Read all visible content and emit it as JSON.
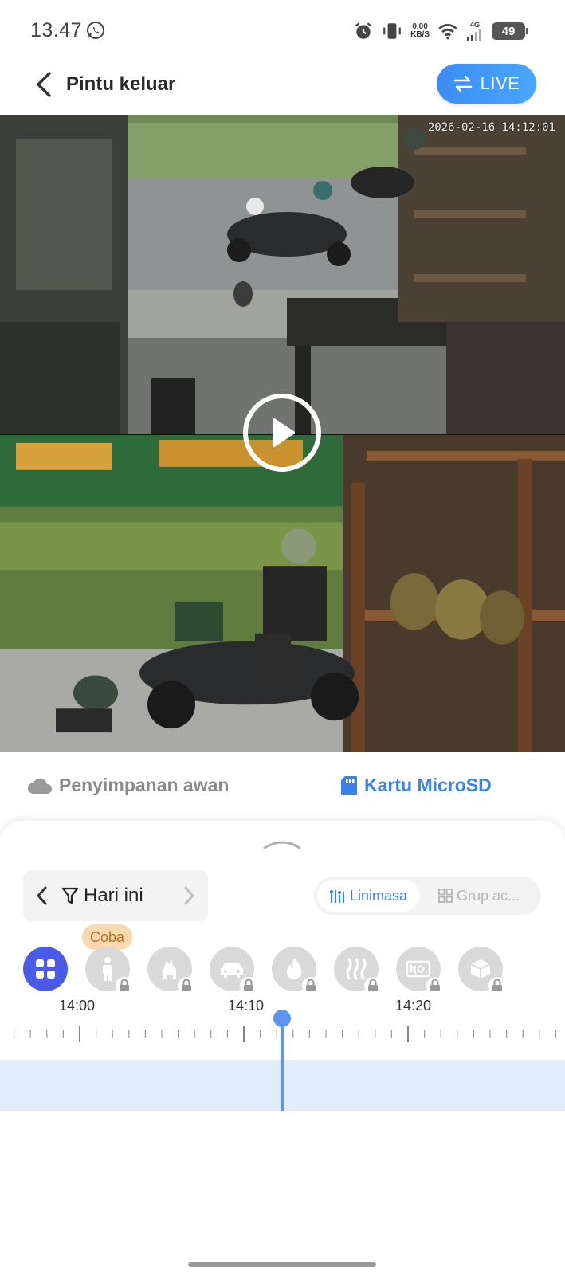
{
  "status_bar": {
    "time": "13.47",
    "net_speed_value": "0,00",
    "net_speed_unit": "KB/S",
    "signal_label": "4G",
    "battery": "49"
  },
  "header": {
    "title": "Pintu keluar",
    "live_label": "LIVE"
  },
  "video": {
    "timestamp": "2026-02-16 14:12:01"
  },
  "storage_tabs": {
    "cloud_label": "Penyimpanan awan",
    "sd_label": "Kartu MicroSD",
    "active": "sd"
  },
  "date_nav": {
    "label": "Hari ini"
  },
  "view_toggle": {
    "timeline_label": "Linimasa",
    "group_label": "Grup ac..."
  },
  "trial_badge": "Coba",
  "filters": [
    {
      "name": "all",
      "icon": "grid-icon",
      "active": true,
      "locked": false
    },
    {
      "name": "person",
      "icon": "person-icon",
      "active": false,
      "locked": true
    },
    {
      "name": "pet",
      "icon": "pet-icon",
      "active": false,
      "locked": true
    },
    {
      "name": "vehicle",
      "icon": "car-icon",
      "active": false,
      "locked": true
    },
    {
      "name": "fire",
      "icon": "fire-icon",
      "active": false,
      "locked": true
    },
    {
      "name": "smoke",
      "icon": "smoke-icon",
      "active": false,
      "locked": true
    },
    {
      "name": "no-plate",
      "icon": "no-plate-icon",
      "active": false,
      "locked": true
    },
    {
      "name": "package",
      "icon": "package-icon",
      "active": false,
      "locked": true
    }
  ],
  "timeline": {
    "labels": [
      "14:00",
      "14:10",
      "14:20"
    ],
    "cursor_time": "14:12:01"
  },
  "colors": {
    "accent": "#3b82e8",
    "active_filter": "#4a5be6",
    "timeline_band": "#e1ecfd",
    "trial_badge": "#fbd9ad"
  }
}
